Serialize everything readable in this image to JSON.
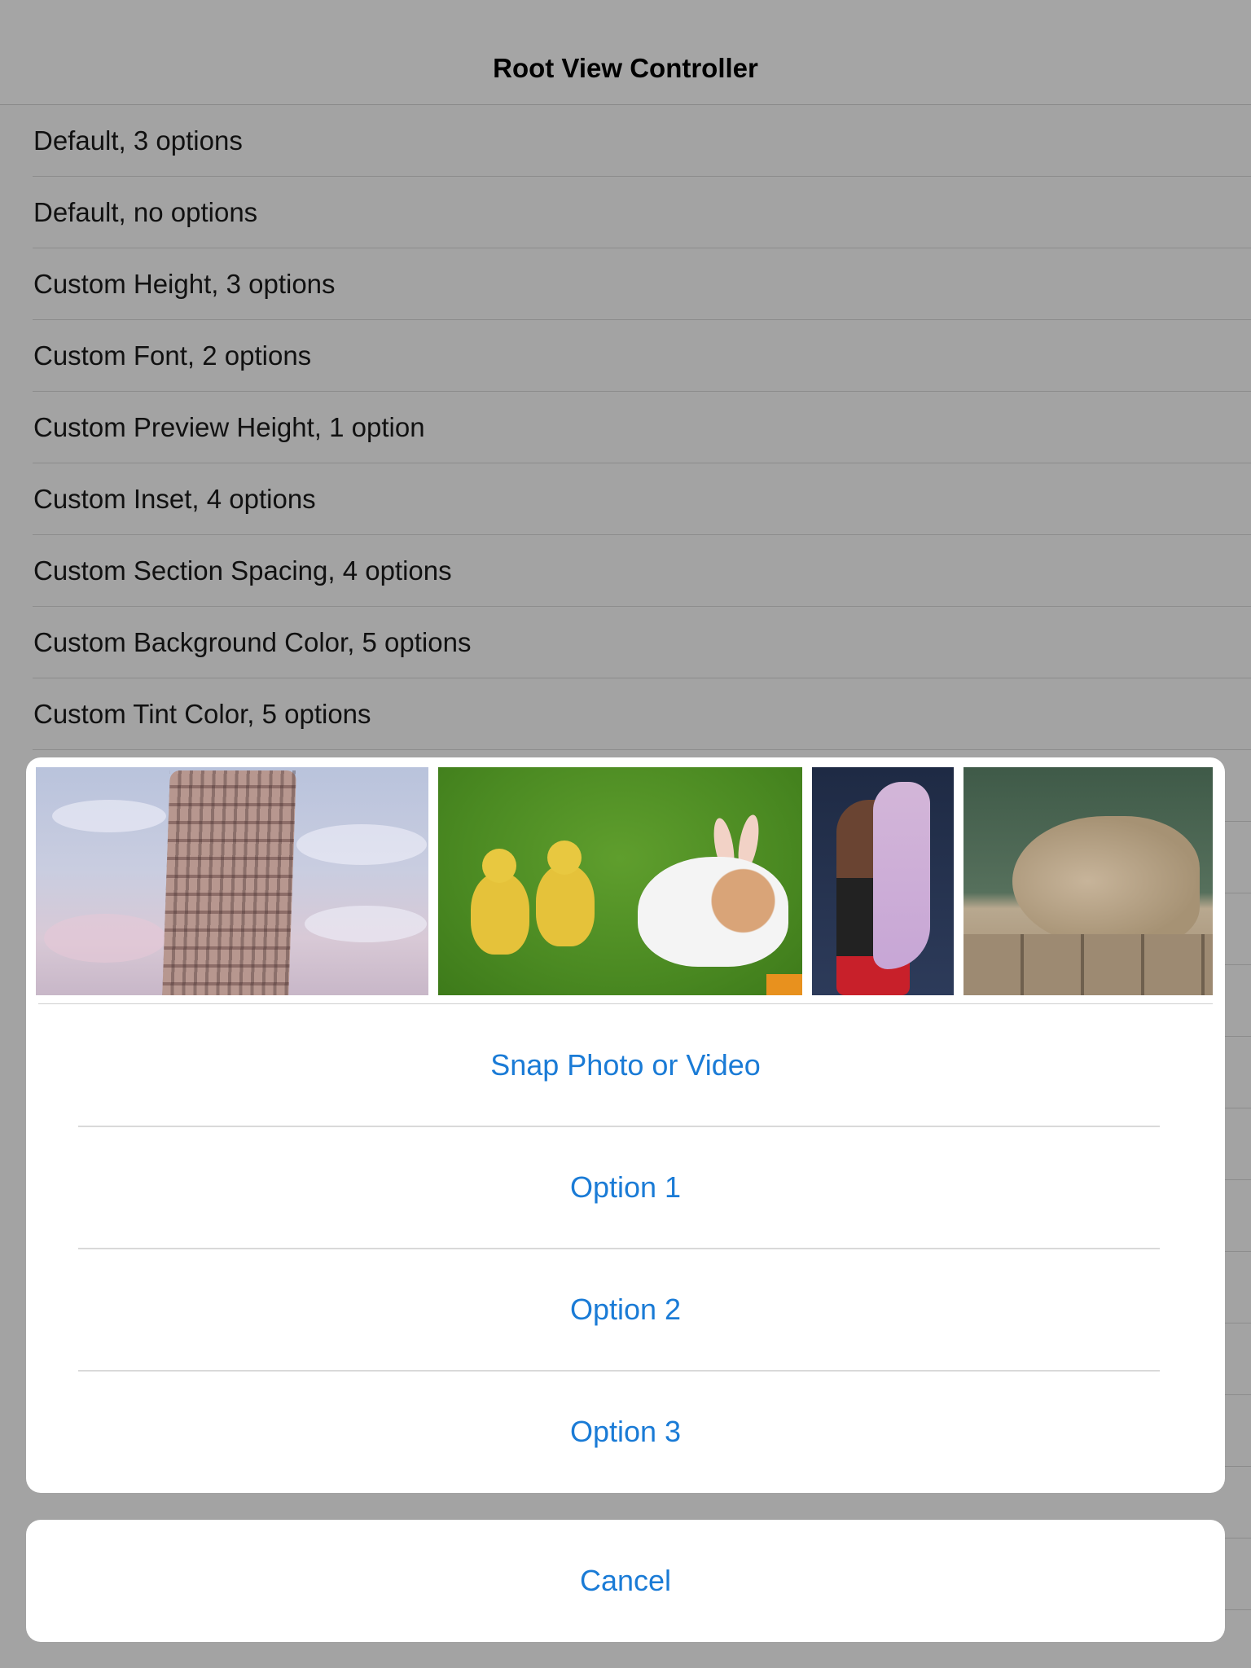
{
  "nav": {
    "title": "Root View Controller"
  },
  "table": {
    "rows": [
      "Default, 3 options",
      "Default, no options",
      "Custom Height, 3 options",
      "Custom Font, 2 options",
      "Custom Preview Height, 1 option",
      "Custom Inset, 4 options",
      "Custom Section Spacing, 4 options",
      "Custom Background Color, 5 options",
      "Custom Tint Color, 5 options"
    ]
  },
  "sheet": {
    "previews": [
      "leaning-tower-photo",
      "ducklings-and-rabbit-photo",
      "athlete-photo",
      "squirrel-photo"
    ],
    "options": [
      "Snap Photo or Video",
      "Option 1",
      "Option 2",
      "Option 3"
    ],
    "cancel": "Cancel",
    "tint_color": "#1a7bd6"
  }
}
